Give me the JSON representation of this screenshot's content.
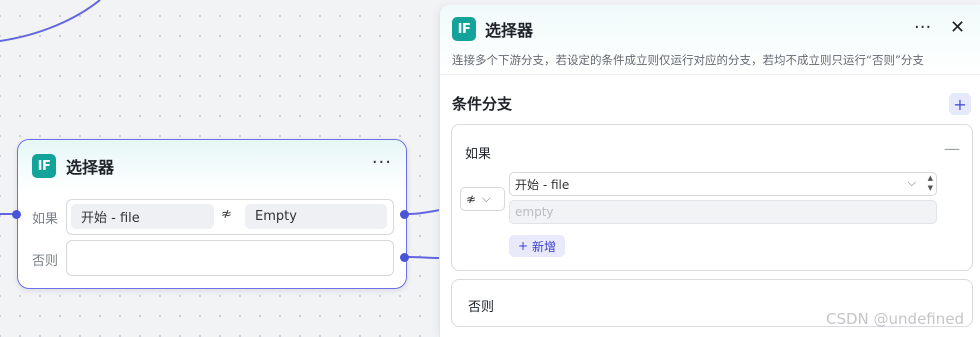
{
  "node": {
    "badge": "IF",
    "title": "选择器",
    "more": "···",
    "if_label": "如果",
    "variable": "开始  -  file",
    "operator": "≉",
    "value": "Empty",
    "else_label": "否则"
  },
  "panel": {
    "badge": "IF",
    "title": "选择器",
    "more": "···",
    "close": "✕",
    "description": "连接多个下游分支，若设定的条件成立则仅运行对应的分支，若均不成立则只运行“否则”分支",
    "section_title": "条件分支",
    "add": "+",
    "branch": {
      "label": "如果",
      "collapse": "—",
      "operator": "≉",
      "operator_chevron": "⌵",
      "variable": "开始 - file",
      "variable_chevron": "⌵",
      "value_placeholder": "empty",
      "add_condition": "新增",
      "add_icon": "+"
    },
    "else_label": "否则"
  },
  "watermark": "CSDN @undefined",
  "colors": {
    "accent": "#4a52d6",
    "node_border": "#6b6fe8",
    "if_badge": "#14a39a"
  }
}
